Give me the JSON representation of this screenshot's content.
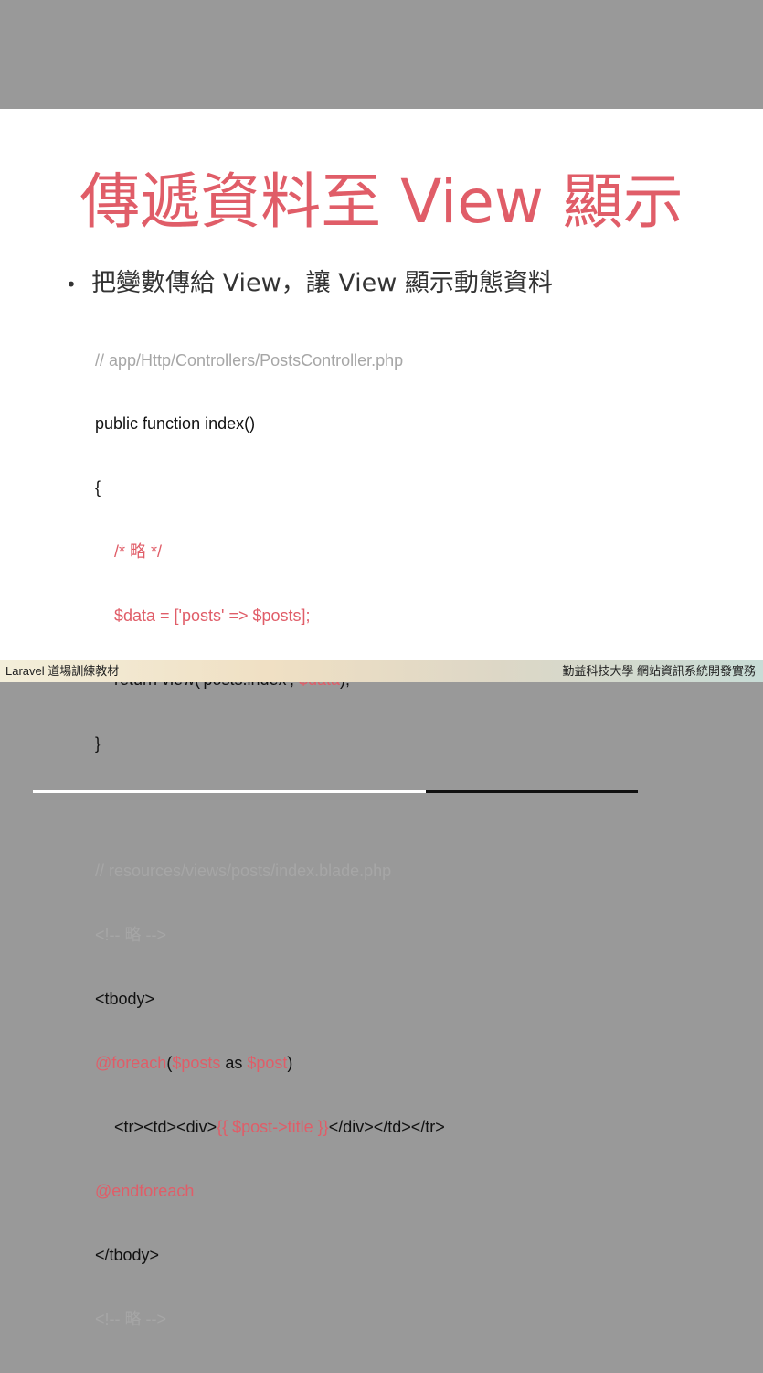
{
  "slide": {
    "title": "傳遞資料至 View 顯示",
    "bullet": "把變數傳給 View，讓 View 顯示動態資料",
    "code_controller": {
      "comment": "// app/Http/Controllers/PostsController.php",
      "signature": "public function index()",
      "open_brace": "{",
      "omit_comment": "/* 略 */",
      "data_line": "$data = ['posts' => $posts];",
      "return_prefix": "return view('posts.index', ",
      "return_var": "$data",
      "return_suffix": ");",
      "close_brace": "}"
    },
    "code_view": {
      "comment": "// resources/views/posts/index.blade.php",
      "omit_open": "<!-- 略 -->",
      "tbody_open": "<tbody>",
      "foreach_kw": "@foreach",
      "foreach_paren_open": "(",
      "foreach_var1": "$posts",
      "foreach_as": " as ",
      "foreach_var2": "$post",
      "foreach_paren_close": ")",
      "row_prefix": "<tr><td><div>",
      "row_echo": "{{ $post->title }}",
      "row_suffix": "</div></td></tr>",
      "endforeach": "@endforeach",
      "tbody_close": "</tbody>",
      "omit_close": "<!-- 略 -->"
    },
    "footer_left": "Laravel 道場訓練教材",
    "footer_right": "勤益科技大學 網站資訊系統開發實務"
  },
  "colors": {
    "accent": "#e05d68",
    "comment": "#a6a6a6",
    "background": "#999999"
  }
}
